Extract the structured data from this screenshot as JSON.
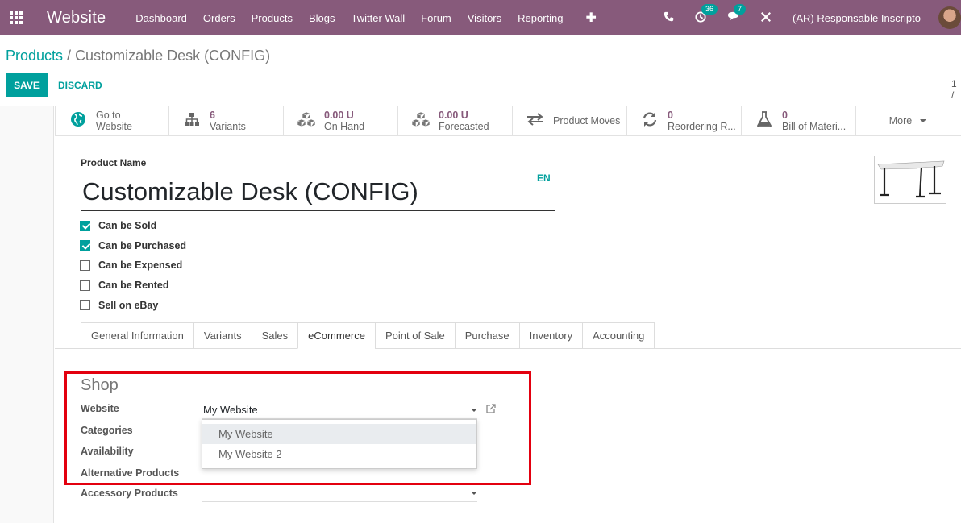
{
  "navbar": {
    "app_title": "Website",
    "menu": [
      "Dashboard",
      "Orders",
      "Products",
      "Blogs",
      "Twitter Wall",
      "Forum",
      "Visitors",
      "Reporting"
    ],
    "activity_count": "36",
    "messages_count": "7",
    "user_name": "(AR) Responsable Inscripto"
  },
  "breadcrumb": {
    "parent": "Products",
    "current": "Customizable Desk (CONFIG)"
  },
  "actions": {
    "save": "SAVE",
    "discard": "DISCARD",
    "pager": "1 /"
  },
  "smart_buttons": [
    {
      "value": "Go to",
      "label": "Website",
      "icon": "globe-icon"
    },
    {
      "value": "6",
      "label": "Variants",
      "icon": "sitemap-icon"
    },
    {
      "value": "0.00 U",
      "label": "On Hand",
      "icon": "cubes-icon"
    },
    {
      "value": "0.00 U",
      "label": "Forecasted",
      "icon": "cubes-icon"
    },
    {
      "value": "",
      "label": "Product Moves",
      "icon": "exchange-icon"
    },
    {
      "value": "0",
      "label": "Reordering R...",
      "icon": "refresh-icon"
    },
    {
      "value": "0",
      "label": "Bill of Materi...",
      "icon": "flask-icon"
    }
  ],
  "more_label": "More",
  "product": {
    "name_label": "Product Name",
    "name": "Customizable Desk (CONFIG)",
    "lang": "EN"
  },
  "checkboxes": [
    {
      "label": "Can be Sold",
      "checked": true
    },
    {
      "label": "Can be Purchased",
      "checked": true
    },
    {
      "label": "Can be Expensed",
      "checked": false
    },
    {
      "label": "Can be Rented",
      "checked": false
    },
    {
      "label": "Sell on eBay",
      "checked": false
    }
  ],
  "tabs": [
    "General Information",
    "Variants",
    "Sales",
    "eCommerce",
    "Point of Sale",
    "Purchase",
    "Inventory",
    "Accounting"
  ],
  "active_tab": "eCommerce",
  "shop": {
    "title": "Shop",
    "website_label": "Website",
    "website_value": "My Website",
    "categories_label": "Categories",
    "availability_label": "Availability",
    "alternative_label": "Alternative Products",
    "accessory_label": "Accessory Products",
    "dropdown_options": [
      "My Website",
      "My Website 2"
    ]
  },
  "colors": {
    "navbar": "#875a7b",
    "primary": "#00a09d",
    "highlight": "#e3000f"
  }
}
